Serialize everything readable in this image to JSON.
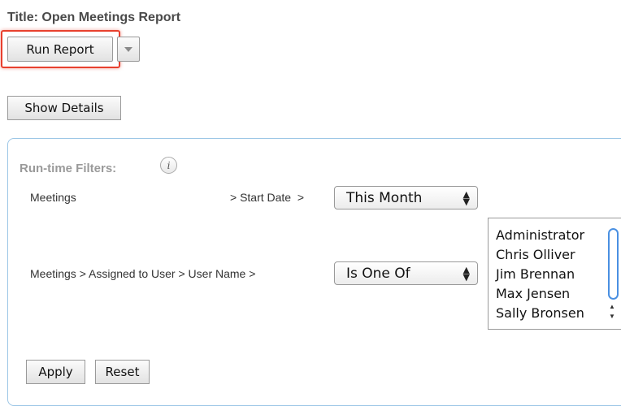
{
  "report": {
    "title": "Title: Open Meetings Report"
  },
  "toolbar": {
    "run_label": "Run Report",
    "details_label": "Show Details"
  },
  "filters": {
    "heading": "Run-time Filters:",
    "info_icon": "info-icon",
    "row1": {
      "module": "Meetings",
      "field": "> Start Date  >",
      "operator": "This Month"
    },
    "row2": {
      "path": "Meetings > Assigned to User > User Name >",
      "operator": "Is One Of",
      "users": [
        "Administrator",
        "Chris Olliver",
        "Jim Brennan",
        "Max Jensen",
        "Sally Bronsen"
      ]
    }
  },
  "actions": {
    "apply_label": "Apply",
    "reset_label": "Reset"
  },
  "colors": {
    "highlight": "#e8402e",
    "panel_border": "#9cc6e6",
    "scroll_thumb": "#4a90e2"
  }
}
